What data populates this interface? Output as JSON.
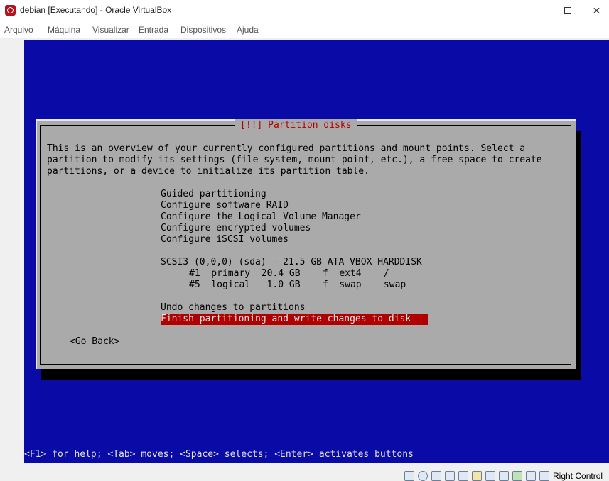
{
  "window": {
    "title": "debian [Executando] - Oracle VirtualBox",
    "icon": "virtualbox-app-icon"
  },
  "menubar": {
    "items": [
      "Arquivo",
      "Máquina",
      "Visualizar",
      "Entrada",
      "Dispositivos",
      "Ajuda"
    ]
  },
  "dialog": {
    "title": "[!!] Partition disks",
    "intro": [
      "This is an overview of your currently configured partitions and mount points. Select a",
      "partition to modify its settings (file system, mount point, etc.), a free space to create",
      "partitions, or a device to initialize its partition table."
    ],
    "options": [
      "Guided partitioning",
      "Configure software RAID",
      "Configure the Logical Volume Manager",
      "Configure encrypted volumes",
      "Configure iSCSI volumes"
    ],
    "disk": "SCSI3 (0,0,0) (sda) - 21.5 GB ATA VBOX HARDDISK",
    "partitions": [
      "#1  primary  20.4 GB    f  ext4    /",
      "#5  logical   1.0 GB    f  swap    swap"
    ],
    "undo": "Undo changes to partitions",
    "finish": "Finish partitioning and write changes to disk",
    "go_back": "<Go Back>"
  },
  "helpbar": "<F1> for help; <Tab> moves; <Space> selects; <Enter> activates buttons",
  "statusbar": {
    "host_key": "Right Control",
    "icons": [
      "hard-disk-icon",
      "optical-drive-icon",
      "audio-icon",
      "network-icon",
      "usb-icon",
      "shared-folder-icon",
      "display-icon",
      "recording-icon",
      "cpu-icon",
      "mouse-integration-icon",
      "keyboard-icon"
    ]
  },
  "colors": {
    "screen_bg": "#0a0aa6",
    "dialog_bg": "#aaaaaa",
    "highlight": "#b00000"
  }
}
